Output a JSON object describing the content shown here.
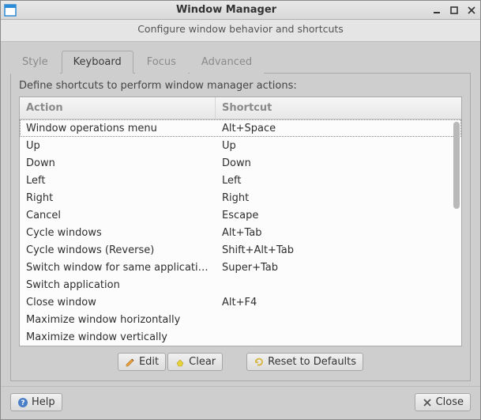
{
  "window": {
    "title": "Window Manager",
    "subtitle": "Configure window behavior and shortcuts"
  },
  "tabs": [
    {
      "label": "Style",
      "active": false
    },
    {
      "label": "Keyboard",
      "active": true
    },
    {
      "label": "Focus",
      "active": false
    },
    {
      "label": "Advanced",
      "active": false
    }
  ],
  "description": "Define shortcuts to perform window manager actions:",
  "columns": {
    "action": "Action",
    "shortcut": "Shortcut"
  },
  "rows": [
    {
      "action": "Window operations menu",
      "shortcut": "Alt+Space",
      "selected": true
    },
    {
      "action": "Up",
      "shortcut": "Up"
    },
    {
      "action": "Down",
      "shortcut": "Down"
    },
    {
      "action": "Left",
      "shortcut": "Left"
    },
    {
      "action": "Right",
      "shortcut": "Right"
    },
    {
      "action": "Cancel",
      "shortcut": "Escape"
    },
    {
      "action": "Cycle windows",
      "shortcut": "Alt+Tab"
    },
    {
      "action": "Cycle windows (Reverse)",
      "shortcut": "Shift+Alt+Tab"
    },
    {
      "action": "Switch window for same application",
      "shortcut": "Super+Tab"
    },
    {
      "action": "Switch application",
      "shortcut": ""
    },
    {
      "action": "Close window",
      "shortcut": "Alt+F4"
    },
    {
      "action": "Maximize window horizontally",
      "shortcut": ""
    },
    {
      "action": "Maximize window vertically",
      "shortcut": ""
    }
  ],
  "buttons": {
    "edit": "Edit",
    "clear": "Clear",
    "reset": "Reset to Defaults",
    "help": "Help",
    "close": "Close"
  }
}
